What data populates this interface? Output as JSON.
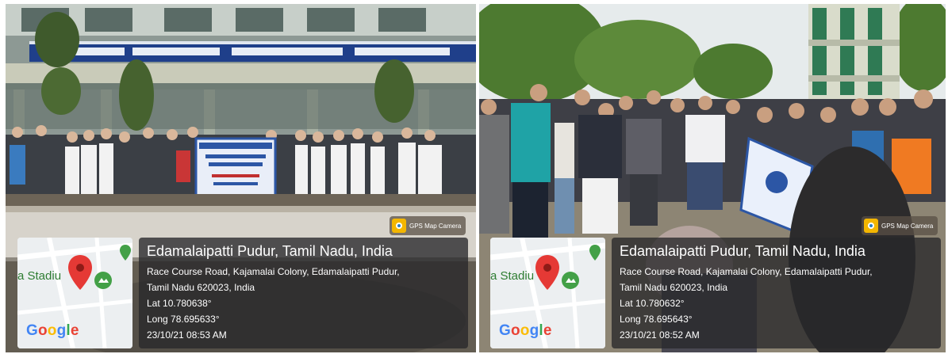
{
  "photos": [
    {
      "watermark_label": "GPS Map Camera",
      "map": {
        "place_label": "a Stadiu",
        "logo_text": "Google"
      },
      "location": {
        "title": "Edamalaipatti Pudur, Tamil Nadu, India",
        "address_line1": "Race Course Road, Kajamalai Colony, Edamalaipatti Pudur,",
        "address_line2": "Tamil Nadu 620023, India",
        "lat": "Lat 10.780638°",
        "long": "Long 78.695633°",
        "timestamp": "23/10/21 08:53 AM"
      }
    },
    {
      "watermark_label": "GPS Map Camera",
      "map": {
        "place_label": "a Stadiu",
        "logo_text": "Google"
      },
      "location": {
        "title": "Edamalaipatti Pudur, Tamil Nadu, India",
        "address_line1": "Race Course Road, Kajamalai Colony, Edamalaipatti Pudur,",
        "address_line2": "Tamil Nadu 620023, India",
        "lat": "Lat 10.780632°",
        "long": "Long 78.695643°",
        "timestamp": "23/10/21 08:52 AM"
      }
    }
  ],
  "colors": {
    "overlay": "#282828",
    "map_pin": "#e53935",
    "badge_icon": "#f3b600",
    "google_blue": "#4285F4",
    "google_red": "#EA4335",
    "google_yellow": "#FBBC05",
    "google_green": "#34A853"
  }
}
